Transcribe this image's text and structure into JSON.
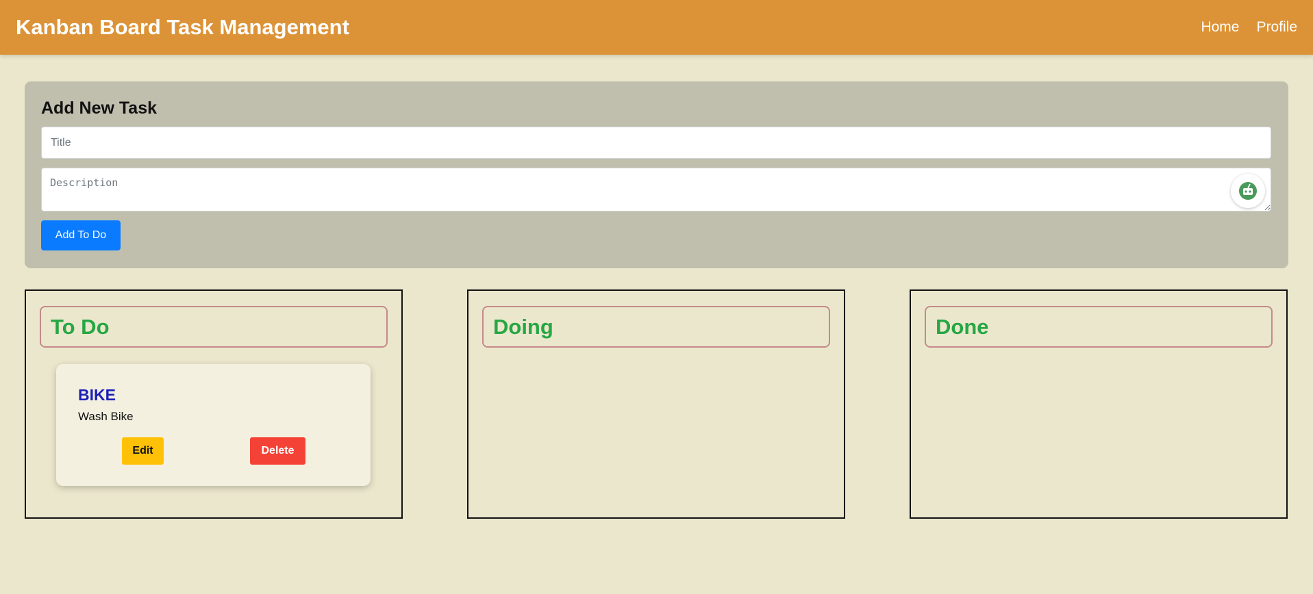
{
  "header": {
    "title": "Kanban Board Task Management",
    "nav": [
      {
        "label": "Home"
      },
      {
        "label": "Profile"
      }
    ]
  },
  "form": {
    "heading": "Add New Task",
    "title_placeholder": "Title",
    "description_placeholder": "Description",
    "submit_label": "Add To Do",
    "assistant_icon": "robot-assistant-icon"
  },
  "columns": [
    {
      "title": "To Do",
      "tasks": [
        {
          "title": "BIKE",
          "description": "Wash Bike",
          "edit_label": "Edit",
          "delete_label": "Delete"
        }
      ]
    },
    {
      "title": "Doing",
      "tasks": []
    },
    {
      "title": "Done",
      "tasks": []
    }
  ],
  "colors": {
    "navbar": "#dc9337",
    "background": "#ebe7cc",
    "form_panel": "#c0bfae",
    "primary_button": "#0a7bff",
    "column_title": "#26a744",
    "task_title": "#1a1fb8",
    "edit_button": "#ffc107",
    "delete_button": "#f44336"
  }
}
